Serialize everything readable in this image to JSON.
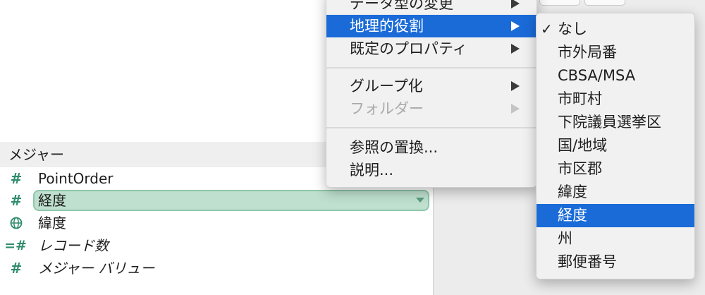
{
  "measures_pane": {
    "header": "メジャー",
    "fields": [
      {
        "name": "PointOrder",
        "icon": "number-hash-icon",
        "italic": false,
        "selected": false
      },
      {
        "name": "経度",
        "icon": "number-hash-icon",
        "italic": false,
        "selected": true
      },
      {
        "name": "緯度",
        "icon": "globe-icon",
        "italic": false,
        "selected": false
      },
      {
        "name": "レコード数",
        "icon": "calculated-number-icon",
        "italic": true,
        "selected": false
      },
      {
        "name": "メジャー バリュー",
        "icon": "number-hash-icon",
        "italic": true,
        "selected": false
      }
    ]
  },
  "context_menu": {
    "items": [
      {
        "label": "データ型の変更",
        "has_submenu": true,
        "state": "normal"
      },
      {
        "label": "地理的役割",
        "has_submenu": true,
        "state": "highlighted"
      },
      {
        "label": "既定のプロパティ",
        "has_submenu": true,
        "state": "normal"
      },
      {
        "label": "グループ化",
        "has_submenu": true,
        "state": "normal"
      },
      {
        "label": "フォルダー",
        "has_submenu": true,
        "state": "disabled"
      },
      {
        "label": "参照の置換...",
        "has_submenu": false,
        "state": "normal"
      },
      {
        "label": "説明...",
        "has_submenu": false,
        "state": "normal"
      }
    ]
  },
  "geographic_role_submenu": {
    "check_symbol": "✓",
    "items": [
      {
        "label": "なし",
        "checked": true,
        "highlighted": false
      },
      {
        "label": "市外局番",
        "checked": false,
        "highlighted": false
      },
      {
        "label": "CBSA/MSA",
        "checked": false,
        "highlighted": false
      },
      {
        "label": "市町村",
        "checked": false,
        "highlighted": false
      },
      {
        "label": "下院議員選挙区",
        "checked": false,
        "highlighted": false
      },
      {
        "label": "国/地域",
        "checked": false,
        "highlighted": false
      },
      {
        "label": "市区郡",
        "checked": false,
        "highlighted": false
      },
      {
        "label": "緯度",
        "checked": false,
        "highlighted": false
      },
      {
        "label": "経度",
        "checked": false,
        "highlighted": true
      },
      {
        "label": "州",
        "checked": false,
        "highlighted": false
      },
      {
        "label": "郵便番号",
        "checked": false,
        "highlighted": false
      }
    ]
  },
  "colors": {
    "highlight": "#1a6bd8",
    "field_icon": "#2e8b6e",
    "selected_pill": "#bfe0cf"
  }
}
